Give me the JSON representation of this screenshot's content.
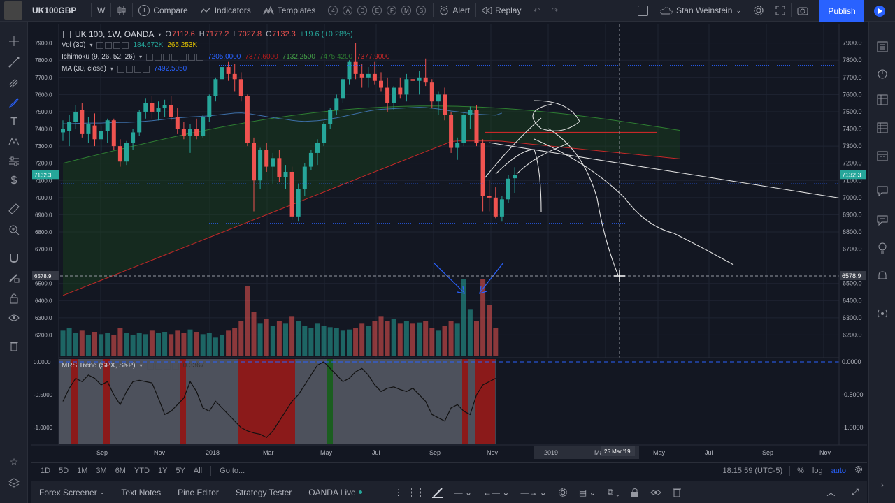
{
  "toolbar": {
    "symbol": "UK100GBP",
    "interval": "W",
    "compare": "Compare",
    "indicators": "Indicators",
    "templates": "Templates",
    "template_circles": [
      "4",
      "A",
      "D",
      "E",
      "F",
      "M",
      "S"
    ],
    "alert": "Alert",
    "replay": "Replay",
    "layout_name": "Stan Weinstein",
    "publish": "Publish"
  },
  "legend": {
    "title": "UK 100, 1W, OANDA",
    "o_label": "O",
    "o": "7112.6",
    "h_label": "H",
    "h": "7177.2",
    "l_label": "L",
    "l": "7027.8",
    "c_label": "C",
    "c": "7132.3",
    "change": "+19.6 (+0.28%)",
    "vol": "Vol (30)",
    "vol_v1": "184.672K",
    "vol_v2": "265.253K",
    "ichimoku": "Ichimoku (9, 26, 52, 26)",
    "ichi_v1": "7205.0000",
    "ichi_v2": "7377.6000",
    "ichi_v3": "7132.2500",
    "ichi_v4": "7475.4200",
    "ichi_v5": "7377.9000",
    "ma": "MA (30, close)",
    "ma_v": "7492.5050",
    "mrs": "MRS Trend (SPX, S&P)",
    "mrs_v": "0.3367"
  },
  "price_axis": {
    "labels": [
      "7900.0",
      "7800.0",
      "7700.0",
      "7600.0",
      "7500.0",
      "7400.0",
      "7300.0",
      "7200.0",
      "7100.0",
      "7000.0",
      "6900.0",
      "6800.0",
      "6700.0",
      "6500.0",
      "6400.0",
      "6300.0",
      "6200.0"
    ],
    "current_price": "7132.3",
    "crosshair_price": "6578.9"
  },
  "mrs_axis": {
    "labels": [
      "0.0000",
      "-0.5000",
      "-1.0000"
    ]
  },
  "time_axis": {
    "labels": [
      "Sep",
      "Nov",
      "2018",
      "Mar",
      "May",
      "Jul",
      "Sep",
      "Nov",
      "2019",
      "Ma",
      "May",
      "Jul",
      "Sep",
      "Nov"
    ],
    "crosshair_date": "25 Mar '19"
  },
  "bottom_bar": {
    "timeframes": [
      "1D",
      "5D",
      "1M",
      "3M",
      "6M",
      "YTD",
      "1Y",
      "5Y",
      "All"
    ],
    "goto": "Go to...",
    "clock": "18:15:59 (UTC-5)",
    "percent": "%",
    "log": "log",
    "auto": "auto"
  },
  "panels": {
    "tabs": [
      "Forex Screener",
      "Text Notes",
      "Pine Editor",
      "Strategy Tester",
      "OANDA Live"
    ]
  },
  "colors": {
    "up": "#26a69a",
    "down": "#ef5350",
    "ma": "#2962ff",
    "cloud": "#1b4d1b",
    "annotation_arrow": "#2962ff"
  },
  "chart_data": {
    "type": "candlestick",
    "title": "UK 100, 1W, OANDA",
    "ylim": [
      6100,
      7980
    ],
    "candles": [
      {
        "o": 7380,
        "h": 7450,
        "l": 7330,
        "c": 7400
      },
      {
        "o": 7390,
        "h": 7480,
        "l": 7300,
        "c": 7440
      },
      {
        "o": 7440,
        "h": 7540,
        "l": 7400,
        "c": 7500
      },
      {
        "o": 7510,
        "h": 7550,
        "l": 7350,
        "c": 7370
      },
      {
        "o": 7370,
        "h": 7470,
        "l": 7320,
        "c": 7430
      },
      {
        "o": 7420,
        "h": 7490,
        "l": 7300,
        "c": 7340
      },
      {
        "o": 7340,
        "h": 7420,
        "l": 7270,
        "c": 7390
      },
      {
        "o": 7390,
        "h": 7460,
        "l": 7320,
        "c": 7450
      },
      {
        "o": 7450,
        "h": 7460,
        "l": 7280,
        "c": 7300
      },
      {
        "o": 7300,
        "h": 7340,
        "l": 7180,
        "c": 7210
      },
      {
        "o": 7210,
        "h": 7330,
        "l": 7190,
        "c": 7320
      },
      {
        "o": 7320,
        "h": 7400,
        "l": 7280,
        "c": 7380
      },
      {
        "o": 7380,
        "h": 7510,
        "l": 7360,
        "c": 7500
      },
      {
        "o": 7500,
        "h": 7580,
        "l": 7460,
        "c": 7550
      },
      {
        "o": 7550,
        "h": 7590,
        "l": 7460,
        "c": 7500
      },
      {
        "o": 7500,
        "h": 7560,
        "l": 7450,
        "c": 7520
      },
      {
        "o": 7520,
        "h": 7570,
        "l": 7470,
        "c": 7540
      },
      {
        "o": 7540,
        "h": 7590,
        "l": 7450,
        "c": 7470
      },
      {
        "o": 7470,
        "h": 7520,
        "l": 7370,
        "c": 7400
      },
      {
        "o": 7400,
        "h": 7440,
        "l": 7340,
        "c": 7360
      },
      {
        "o": 7360,
        "h": 7430,
        "l": 7260,
        "c": 7400
      },
      {
        "o": 7400,
        "h": 7460,
        "l": 7340,
        "c": 7360
      },
      {
        "o": 7360,
        "h": 7480,
        "l": 7350,
        "c": 7470
      },
      {
        "o": 7470,
        "h": 7600,
        "l": 7440,
        "c": 7590
      },
      {
        "o": 7590,
        "h": 7700,
        "l": 7560,
        "c": 7690
      },
      {
        "o": 7690,
        "h": 7780,
        "l": 7640,
        "c": 7760
      },
      {
        "o": 7760,
        "h": 7790,
        "l": 7680,
        "c": 7720
      },
      {
        "o": 7720,
        "h": 7780,
        "l": 7620,
        "c": 7690
      },
      {
        "o": 7690,
        "h": 7730,
        "l": 7560,
        "c": 7590
      },
      {
        "o": 7590,
        "h": 7600,
        "l": 7300,
        "c": 7320
      },
      {
        "o": 7320,
        "h": 7350,
        "l": 6920,
        "c": 7100
      },
      {
        "o": 7100,
        "h": 7290,
        "l": 7050,
        "c": 7280
      },
      {
        "o": 7280,
        "h": 7320,
        "l": 7150,
        "c": 7180
      },
      {
        "o": 7180,
        "h": 7260,
        "l": 7080,
        "c": 7230
      },
      {
        "o": 7230,
        "h": 7280,
        "l": 7090,
        "c": 7120
      },
      {
        "o": 7120,
        "h": 7190,
        "l": 7050,
        "c": 7150
      },
      {
        "o": 7150,
        "h": 7180,
        "l": 6870,
        "c": 6890
      },
      {
        "o": 6890,
        "h": 7080,
        "l": 6860,
        "c": 7050
      },
      {
        "o": 7050,
        "h": 7200,
        "l": 7010,
        "c": 7180
      },
      {
        "o": 7180,
        "h": 7280,
        "l": 7160,
        "c": 7260
      },
      {
        "o": 7260,
        "h": 7340,
        "l": 7190,
        "c": 7320
      },
      {
        "o": 7320,
        "h": 7440,
        "l": 7300,
        "c": 7430
      },
      {
        "o": 7430,
        "h": 7520,
        "l": 7400,
        "c": 7510
      },
      {
        "o": 7510,
        "h": 7600,
        "l": 7480,
        "c": 7580
      },
      {
        "o": 7580,
        "h": 7700,
        "l": 7550,
        "c": 7690
      },
      {
        "o": 7690,
        "h": 7800,
        "l": 7660,
        "c": 7790
      },
      {
        "o": 7790,
        "h": 7900,
        "l": 7690,
        "c": 7720
      },
      {
        "o": 7720,
        "h": 7780,
        "l": 7640,
        "c": 7700
      },
      {
        "o": 7700,
        "h": 7760,
        "l": 7640,
        "c": 7720
      },
      {
        "o": 7720,
        "h": 7790,
        "l": 7660,
        "c": 7680
      },
      {
        "o": 7680,
        "h": 7730,
        "l": 7620,
        "c": 7640
      },
      {
        "o": 7640,
        "h": 7700,
        "l": 7500,
        "c": 7550
      },
      {
        "o": 7550,
        "h": 7650,
        "l": 7510,
        "c": 7640
      },
      {
        "o": 7640,
        "h": 7700,
        "l": 7580,
        "c": 7600
      },
      {
        "o": 7600,
        "h": 7720,
        "l": 7560,
        "c": 7690
      },
      {
        "o": 7690,
        "h": 7750,
        "l": 7620,
        "c": 7680
      },
      {
        "o": 7680,
        "h": 7740,
        "l": 7600,
        "c": 7700
      },
      {
        "o": 7700,
        "h": 7810,
        "l": 7650,
        "c": 7670
      },
      {
        "o": 7670,
        "h": 7690,
        "l": 7520,
        "c": 7560
      },
      {
        "o": 7560,
        "h": 7620,
        "l": 7480,
        "c": 7600
      },
      {
        "o": 7600,
        "h": 7640,
        "l": 7450,
        "c": 7480
      },
      {
        "o": 7480,
        "h": 7500,
        "l": 7260,
        "c": 7290
      },
      {
        "o": 7290,
        "h": 7350,
        "l": 7220,
        "c": 7320
      },
      {
        "o": 7320,
        "h": 7500,
        "l": 7300,
        "c": 7480
      },
      {
        "o": 7480,
        "h": 7530,
        "l": 7400,
        "c": 7510
      },
      {
        "o": 7510,
        "h": 7540,
        "l": 7300,
        "c": 7320
      },
      {
        "o": 7320,
        "h": 7340,
        "l": 6920,
        "c": 7010
      },
      {
        "o": 7010,
        "h": 7100,
        "l": 6920,
        "c": 7000
      },
      {
        "o": 7000,
        "h": 7060,
        "l": 6880,
        "c": 6890
      },
      {
        "o": 6890,
        "h": 7010,
        "l": 6860,
        "c": 6990
      },
      {
        "o": 6990,
        "h": 7130,
        "l": 6970,
        "c": 7110
      },
      {
        "o": 7112.6,
        "h": 7177.2,
        "l": 7027.8,
        "c": 7132.3
      }
    ],
    "volume": [
      22,
      24,
      20,
      22,
      18,
      21,
      19,
      20,
      18,
      24,
      20,
      18,
      20,
      19,
      22,
      20,
      21,
      19,
      22,
      20,
      23,
      21,
      19,
      20,
      16,
      18,
      22,
      24,
      30,
      60,
      38,
      28,
      32,
      26,
      30,
      28,
      34,
      30,
      26,
      24,
      28,
      26,
      25,
      24,
      22,
      23,
      24,
      28,
      26,
      30,
      34,
      30,
      32,
      28,
      30,
      28,
      29,
      30,
      24,
      22,
      26,
      30,
      28,
      66,
      40,
      30,
      66,
      44,
      24
    ],
    "ma": [
      7430,
      7430,
      7432,
      7433,
      7434,
      7434,
      7434,
      7436,
      7437,
      7438,
      7438,
      7440,
      7442,
      7445,
      7448,
      7452,
      7456,
      7460,
      7464,
      7467,
      7470,
      7472,
      7474,
      7476,
      7480,
      7484,
      7488,
      7492,
      7493,
      7490,
      7484,
      7478,
      7472,
      7466,
      7460,
      7456,
      7450,
      7446,
      7444,
      7446,
      7448,
      7452,
      7458,
      7464,
      7472,
      7480,
      7488,
      7496,
      7504,
      7510,
      7514,
      7516,
      7518,
      7520,
      7522,
      7524,
      7526,
      7524,
      7520,
      7516,
      7510,
      7504,
      7500,
      7494,
      7490,
      7486,
      7484,
      7482,
      7480,
      7492
    ],
    "mrs": [
      -0.6,
      -0.4,
      -0.25,
      -0.3,
      -0.2,
      -0.25,
      -0.35,
      -0.3,
      -0.5,
      -0.65,
      -0.45,
      -0.3,
      -0.28,
      -0.3,
      -0.32,
      -0.55,
      -0.8,
      -0.75,
      -0.65,
      -0.55,
      -0.3,
      -0.45,
      -0.7,
      -0.75,
      -0.6,
      -0.7,
      -0.8,
      -0.9,
      -1.0,
      -1.05,
      -1.08,
      -1.1,
      -1.15,
      -1.05,
      -0.9,
      -0.75,
      -0.6,
      -0.5,
      -0.35,
      -0.2,
      -0.05,
      0.0,
      -0.1,
      -0.2,
      -0.3,
      -0.25,
      -0.15,
      -0.1,
      -0.2,
      -0.35,
      -0.45,
      -0.4,
      -0.38,
      -0.42,
      -0.45,
      -0.4,
      -0.5,
      -0.6,
      -0.8,
      -0.85,
      -0.9,
      -0.7,
      -0.65,
      -0.75,
      -0.8,
      -0.5,
      -0.35,
      -0.3,
      -0.25
    ]
  }
}
